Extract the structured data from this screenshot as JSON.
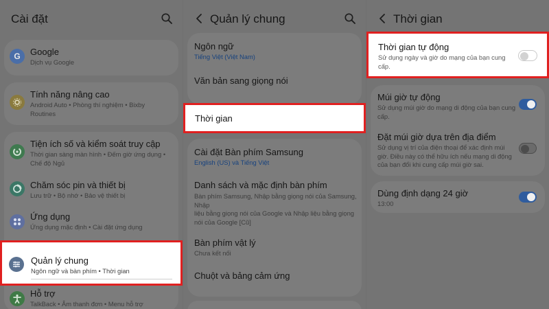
{
  "colors": {
    "highlight_border": "#e02020",
    "toggle_on": "#2f5c9e",
    "link_blue": "#17427e"
  },
  "panel1": {
    "title": "Cài đặt",
    "items": [
      {
        "label": "Google",
        "sub": "Dịch vụ Google",
        "icon": "google-icon"
      },
      {
        "label": "Tính năng nâng cao",
        "sub": "Android Auto  •  Phòng thí nghiệm  •  Bixby\nRoutines",
        "icon": "advanced-features-icon"
      },
      {
        "label": "Tiện ích số và kiểm soát truy cập",
        "sub": "Thời gian sàng màn hình  •  Đếm giờ ứng dụng  •\nChế độ Ngủ",
        "icon": "digital-wellbeing-icon"
      },
      {
        "label": "Chăm sóc pin và thiết bị",
        "sub": "Lưu trữ  •  Bộ nhớ  •  Bảo vệ thiết bị",
        "icon": "device-care-icon"
      },
      {
        "label": "Ứng dụng",
        "sub": "Ứng dụng mặc định  •  Cài đặt ứng dụng",
        "icon": "apps-icon"
      },
      {
        "label": "Quản lý chung",
        "sub": "Ngôn ngữ và bàn phím  •  Thời gian",
        "icon": "general-management-icon"
      },
      {
        "label": "Hỗ trợ",
        "sub": "TalkBack  •  Âm thanh đơn  •  Menu hỗ trợ",
        "icon": "accessibility-icon"
      }
    ]
  },
  "panel2": {
    "title": "Quản lý chung",
    "items": [
      {
        "label": "Ngôn ngữ",
        "sub": "Tiếng Việt (Việt Nam)"
      },
      {
        "label": "Văn bản sang giọng nói"
      },
      {
        "label": "Thời gian"
      },
      {
        "label": "Cài đặt Bàn phím Samsung",
        "sub": "English (US) và Tiếng Việt"
      },
      {
        "label": "Danh sách và mặc định bàn phím",
        "sub": "Bàn phím Samsung, Nhập bằng giọng nói của Samsung, Nhập\nliệu bằng giọng nói của Google và Nhập liệu bằng giọng\nnói của Google [Cũ]"
      },
      {
        "label": "Bàn phím vật lý",
        "sub": "Chưa kết nối"
      },
      {
        "label": "Chuột và bảng cảm ứng"
      }
    ]
  },
  "panel3": {
    "title": "Thời gian",
    "items": [
      {
        "label": "Thời gian tự động",
        "sub": "Sử dụng ngày và giờ do mạng của bạn cung\ncấp.",
        "enabled": false
      },
      {
        "label": "Múi giờ tự động",
        "sub": "Sử dụng múi giờ do mạng di động của bạn cung\ncấp.",
        "enabled": true
      },
      {
        "label": "Đặt múi giờ dựa trên địa điểm",
        "sub": "Sử dụng vị trí của điện thoại để xác định múi\ngiờ. Điều này có thể hữu ích nếu mạng di động\ncủa bạn đổi khi cung cấp múi giờ sai.",
        "enabled": false
      },
      {
        "label": "Dùng định dạng 24 giờ",
        "sub": "13:00",
        "enabled": true
      }
    ]
  }
}
